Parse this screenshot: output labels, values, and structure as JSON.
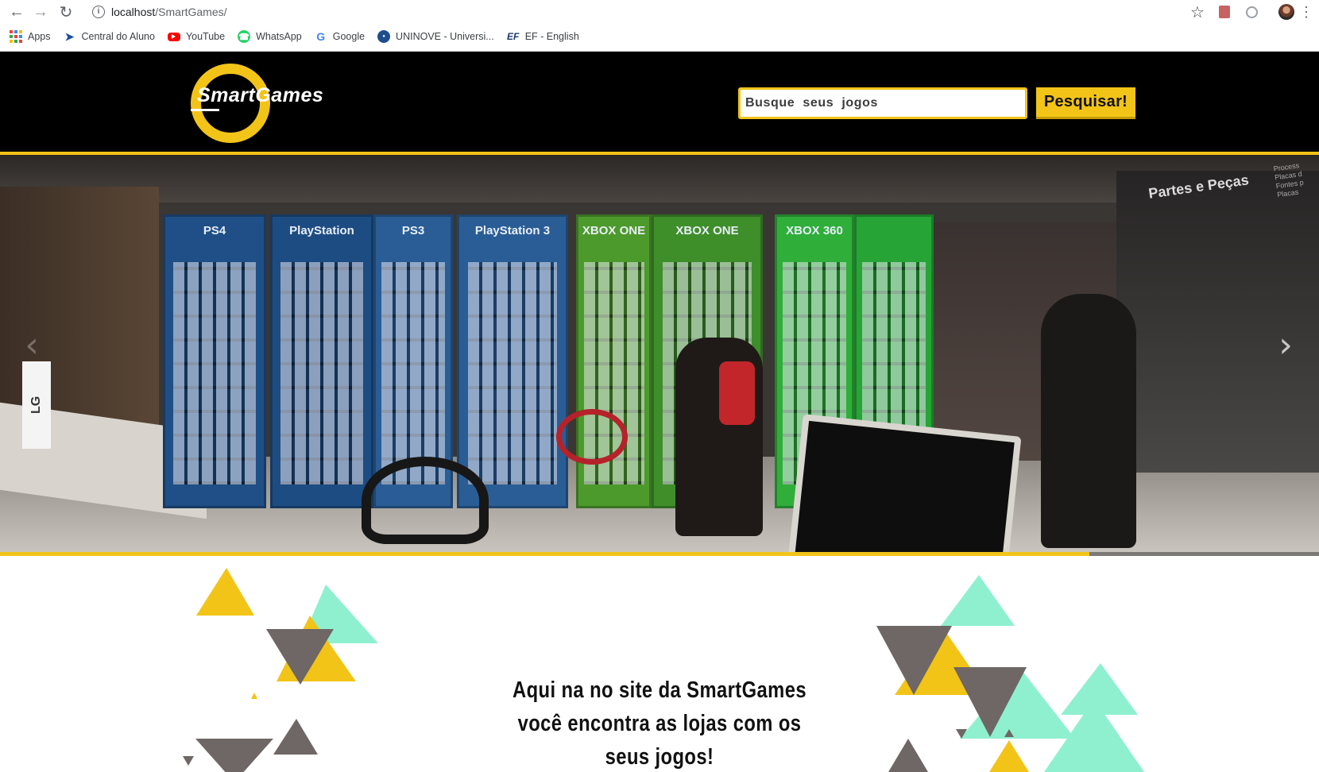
{
  "browser": {
    "url_host": "localhost",
    "url_path": "/SmartGames/",
    "bookmarks": [
      {
        "label": "Apps",
        "icon": "apps-icon"
      },
      {
        "label": "Central do Aluno",
        "icon": "central-aluno-icon"
      },
      {
        "label": "YouTube",
        "icon": "youtube-icon"
      },
      {
        "label": "WhatsApp",
        "icon": "whatsapp-icon"
      },
      {
        "label": "Google",
        "icon": "google-icon"
      },
      {
        "label": "UNINOVE - Universi...",
        "icon": "uninove-icon"
      },
      {
        "label": "EF - English",
        "icon": "ef-icon"
      }
    ]
  },
  "header": {
    "logo_text": "SmartGames",
    "search_placeholder": "Busque  seus  jogos",
    "search_button": "Pesquisar!"
  },
  "hero": {
    "shelf_labels": [
      "PS4",
      "PlayStation",
      "PS3",
      "PlayStation 3",
      "XBOX ONE",
      "XBOX ONE",
      "XBOX 360",
      ""
    ],
    "right_sign": "Partes e Peças",
    "right_sign_list": "Process\nPlacas d\nFontes p\nPlacas",
    "lg_sign": "LG",
    "arrow_prev": "‹",
    "arrow_next": "›",
    "progress_fraction": 0.826
  },
  "content": {
    "headline": "Aqui na no site da SmartGames você encontra as lojas com os seus jogos!"
  },
  "colors": {
    "accent_yellow": "#f2c418",
    "mint": "#8ff0cf",
    "grey": "#6e6765",
    "header_bg": "#000000"
  }
}
